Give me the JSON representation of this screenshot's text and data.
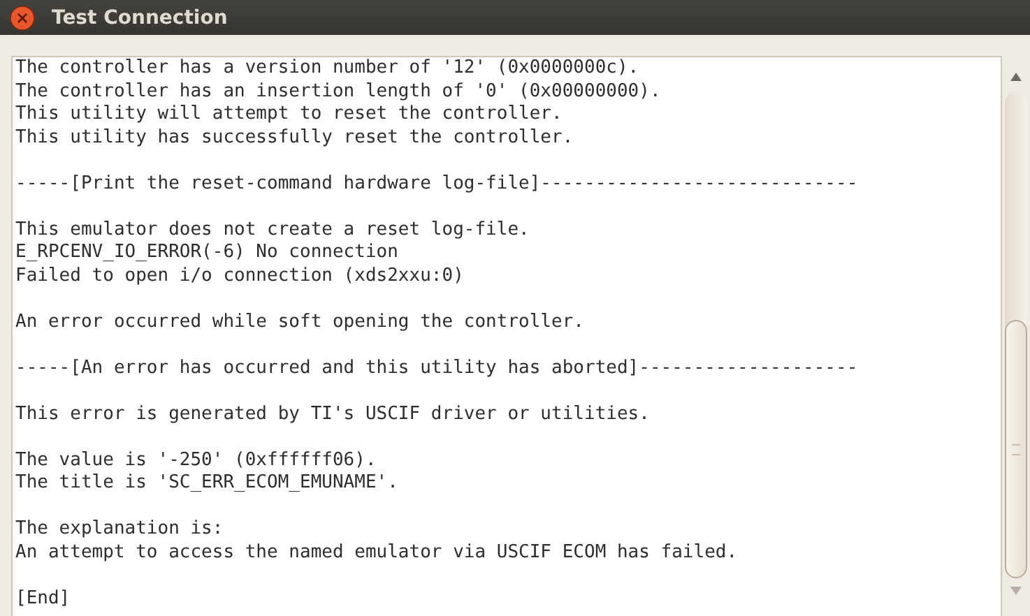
{
  "window": {
    "title": "Test Connection"
  },
  "log": {
    "blocks": [
      [
        "The controller has a version number of '12' (0x0000000c).",
        "The controller has an insertion length of '0' (0x00000000).",
        "This utility will attempt to reset the controller.",
        "This utility has successfully reset the controller."
      ],
      [
        "-----[Print the reset-command hardware log-file]-----------------------------"
      ],
      [
        "This emulator does not create a reset log-file.",
        "E_RPCENV_IO_ERROR(-6) No connection",
        "Failed to open i/o connection (xds2xxu:0)"
      ],
      [
        "An error occurred while soft opening the controller."
      ],
      [
        "-----[An error has occurred and this utility has aborted]--------------------"
      ],
      [
        "This error is generated by TI's USCIF driver or utilities."
      ],
      [
        "The value is '-250' (0xffffff06).",
        "The title is 'SC_ERR_ECOM_EMUNAME'."
      ],
      [
        "The explanation is:",
        "An attempt to access the named emulator via USCIF ECOM has failed."
      ],
      [
        "[End]"
      ]
    ]
  }
}
